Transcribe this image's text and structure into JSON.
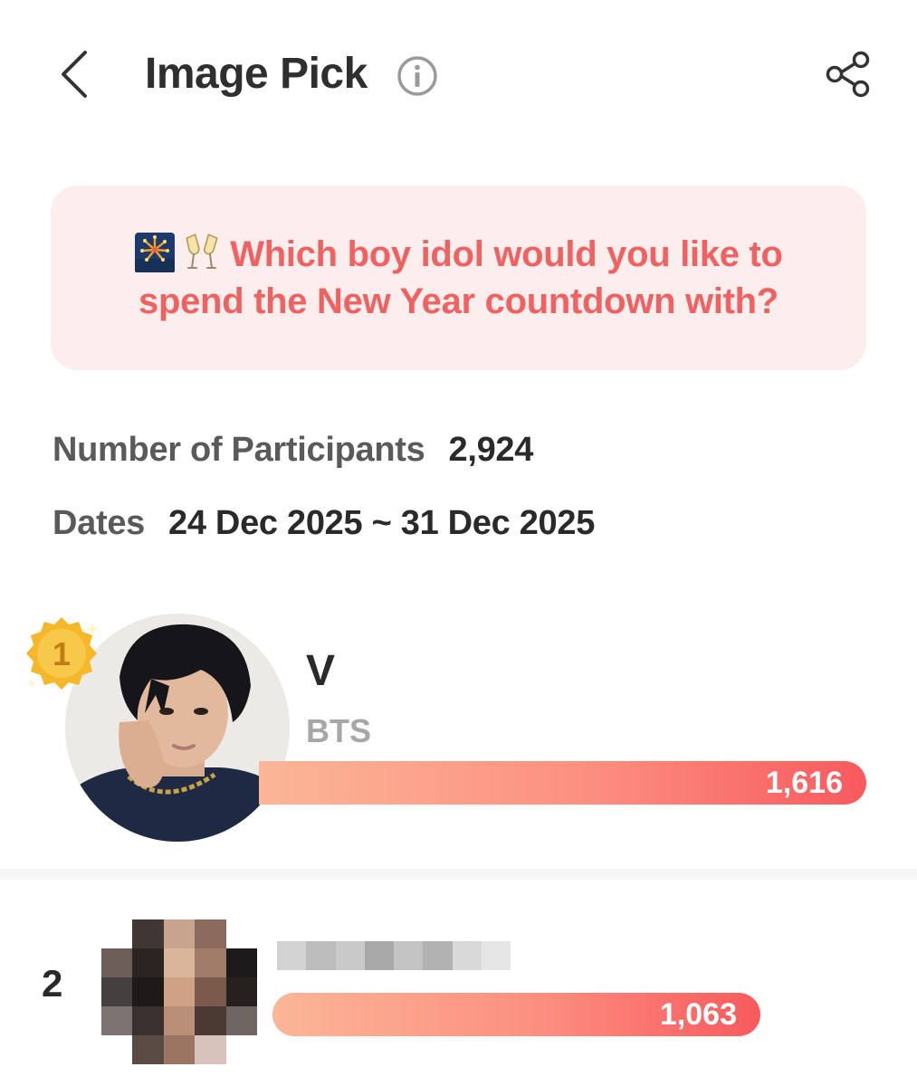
{
  "header": {
    "title": "Image Pick",
    "back_icon": "chevron-left-icon",
    "info_icon": "info-icon",
    "share_icon": "share-icon"
  },
  "question": {
    "emojis": [
      "fireworks-emoji",
      "clinking-glasses-emoji"
    ],
    "text": "Which boy idol would you like to spend the New Year countdown with?",
    "color": "#f06262",
    "background": "#fdeeee"
  },
  "meta": {
    "participants_label": "Number of Participants",
    "participants_value": "2,924",
    "dates_label": "Dates",
    "dates_value": "24 Dec 2025 ~ 31 Dec 2025"
  },
  "ranking": [
    {
      "rank": "1",
      "name": "V",
      "group": "BTS",
      "votes": "1,616",
      "vote_count": 1616,
      "badge": "gold-medal-icon"
    },
    {
      "rank": "2",
      "name_obscured": true,
      "votes": "1,063",
      "vote_count": 1063
    }
  ],
  "colors": {
    "bar_start": "#fbb697",
    "bar_end": "#f85a5d",
    "medal": "#f5b82a"
  }
}
